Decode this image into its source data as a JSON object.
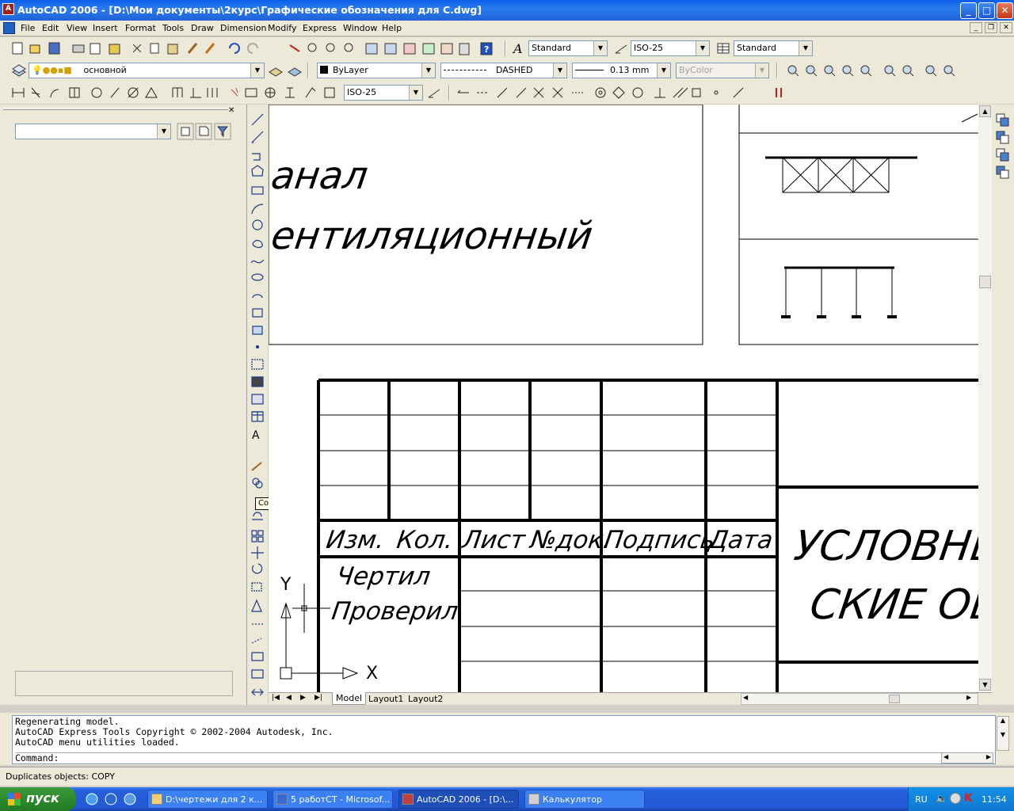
{
  "window": {
    "title": "AutoCAD 2006 - [D:\\Мои документы\\2курс\\Графические обозначения для С.dwg]"
  },
  "menu": [
    "File",
    "Edit",
    "View",
    "Insert",
    "Format",
    "Tools",
    "Draw",
    "Dimension",
    "Modify",
    "Express",
    "Window",
    "Help"
  ],
  "styles_toolbar": {
    "text_style": "Standard",
    "dim_style": "ISO-25",
    "table_style": "Standard"
  },
  "layers_toolbar": {
    "layer": "основной"
  },
  "properties_toolbar": {
    "color": "ByLayer",
    "linetype": "DASHED",
    "lineweight": "0.13 mm",
    "plotstyle": "ByColor"
  },
  "dim_toolbar": {
    "dim_style": "ISO-25"
  },
  "tooltip": "Copy",
  "drawing": {
    "line1": "анал",
    "line2": "ентиляционный",
    "headers": [
      "Изм.",
      "Кол.",
      "Лист",
      "№док.",
      "Подпись",
      "Дата"
    ],
    "drawn_by": "Чертил",
    "checked_by": "Проверил",
    "title1": "УСЛОВНЬ",
    "title2": "СКИЕ ОБ",
    "ucs_y": "Y",
    "ucs_x": "X"
  },
  "layout_tabs": [
    "Model",
    "Layout1",
    "Layout2"
  ],
  "command_history": [
    "Regenerating model.",
    "AutoCAD Express Tools Copyright © 2002-2004 Autodesk, Inc.",
    "AutoCAD menu utilities loaded."
  ],
  "command_prompt": "Command:",
  "status_text": "Duplicates objects:  COPY",
  "taskbar": {
    "start": "пуск",
    "tasks": [
      "D:\\чертежи для 2 к...",
      "5 работСТ - Microsof...",
      "AutoCAD 2006 - [D:\\...",
      "Калькулятор"
    ],
    "lang": "RU",
    "clock": "11:54"
  }
}
